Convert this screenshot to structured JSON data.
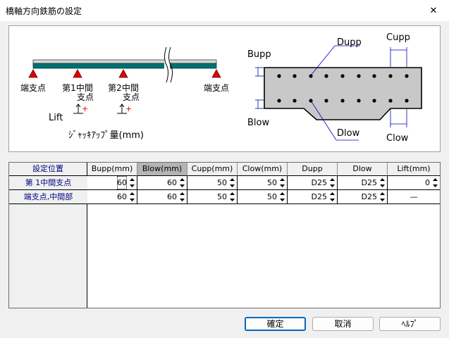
{
  "window": {
    "title": "橋軸方向鉄筋の設定",
    "close_symbol": "✕"
  },
  "diagram": {
    "supports": [
      {
        "label_lines": [
          "端支点"
        ]
      },
      {
        "label_lines": [
          "第1中間",
          "支点"
        ]
      },
      {
        "label_lines": [
          "第2中間",
          "支点"
        ]
      },
      {
        "label_lines": [
          "端支点"
        ]
      }
    ],
    "lift_label": "Lift",
    "jack_label": "ｼﾞｬｯｷｱｯﾌﾟ量(mm)",
    "section_labels": {
      "bupp": "Bupp",
      "blow": "Blow",
      "dupp": "Dupp",
      "dlow": "Dlow",
      "cupp": "Cupp",
      "clow": "Clow"
    },
    "colors": {
      "girder": "#007070",
      "support": "#e00000",
      "slab": "#c8c8c8",
      "leader": "#0000c0"
    }
  },
  "grid": {
    "corner_label": "設定位置",
    "columns": [
      "Bupp(mm)",
      "Blow(mm)",
      "Cupp(mm)",
      "Clow(mm)",
      "Dupp",
      "Dlow",
      "Lift(mm)"
    ],
    "selected_column": 1,
    "rows": [
      {
        "label": "第 1中間支点",
        "values": [
          "60",
          "60",
          "50",
          "50",
          "D25",
          "D25",
          "0"
        ]
      },
      {
        "label": "端支点,中間部",
        "values": [
          "60",
          "60",
          "50",
          "50",
          "D25",
          "D25",
          "—"
        ]
      }
    ]
  },
  "buttons": {
    "ok": "確定",
    "cancel": "取消",
    "help": "ﾍﾙﾌﾟ"
  }
}
